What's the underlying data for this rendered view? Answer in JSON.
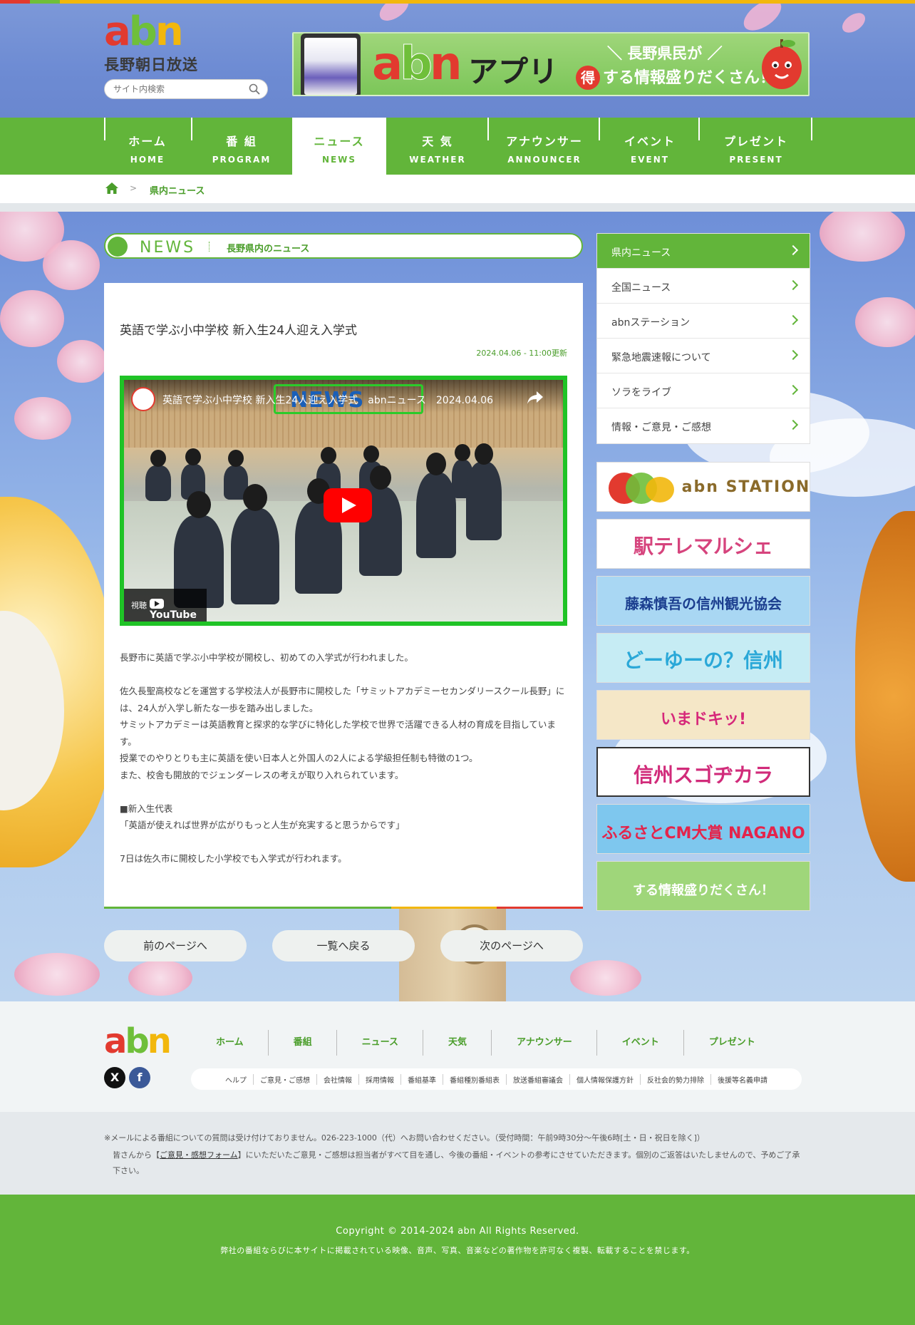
{
  "site": {
    "logo_sub": "長野朝日放送",
    "search_placeholder": "サイト内検索"
  },
  "header_banner": {
    "app_word": "アプリ",
    "tagline_1": "＼ 長野県民が ／",
    "toku": "得",
    "tagline_2": "する情報盛りだくさん！"
  },
  "gnav": [
    {
      "jp": "ホーム",
      "en": "HOME"
    },
    {
      "jp": "番 組",
      "en": "PROGRAM"
    },
    {
      "jp": "ニュース",
      "en": "NEWS"
    },
    {
      "jp": "天 気",
      "en": "WEATHER"
    },
    {
      "jp": "アナウンサー",
      "en": "ANNOUNCER"
    },
    {
      "jp": "イベント",
      "en": "EVENT"
    },
    {
      "jp": "プレゼント",
      "en": "PRESENT"
    }
  ],
  "breadcrumb": {
    "separator": ">",
    "current": "県内ニュース"
  },
  "news_bar": {
    "label": "NEWS",
    "sub": "長野県内のニュース"
  },
  "article": {
    "title": "英語で学ぶ小中学校 新入生24人迎え入学式",
    "date": "2024.04.06 - 11:00更新",
    "video": {
      "title": "英語で学ぶ小中学校 新入生24人迎え入学式　abnニュース　2024.04.06",
      "newsbox": "NEWS",
      "watch_label": "視聴",
      "yt_label": "YouTube"
    },
    "paragraphs": [
      "長野市に英語で学ぶ小中学校が開校し、初めての入学式が行われました。",
      "",
      "佐久長聖高校などを運営する学校法人が長野市に開校した「サミットアカデミーセカンダリースクール長野」には、24人が入学し新たな一歩を踏み出しました。",
      "サミットアカデミーは英語教育と探求的な学びに特化した学校で世界で活躍できる人材の育成を目指しています。",
      "授業でのやりとりも主に英語を使い日本人と外国人の2人による学級担任制も特徴の1つ。",
      "また、校舎も開放的でジェンダーレスの考えが取り入れられています。",
      "",
      "■新入生代表",
      "「英語が使えれば世界が広がりもっと人生が充実すると思うからです」",
      "",
      "7日は佐久市に開校した小学校でも入学式が行われます。"
    ]
  },
  "pager": {
    "prev": "前のページへ",
    "list": "一覧へ戻る",
    "next": "次のページへ"
  },
  "side_menu": [
    "県内ニュース",
    "全国ニュース",
    "abnステーション",
    "緊急地震速報について",
    "ソラをライブ",
    "情報・ご意見・ご感想"
  ],
  "side_banners": [
    {
      "text": "abn STATION",
      "bg": "#ffffff",
      "color": "#8a6a2a"
    },
    {
      "text": "駅テレマルシェ",
      "bg": "#ffffff",
      "color": "#d6447d"
    },
    {
      "text": "藤森慎吾の信州観光協会",
      "bg": "#a9d7f3",
      "color": "#1b3e8f"
    },
    {
      "text": "どーゆーの？信州",
      "bg": "#c6ecf4",
      "color": "#2aa8d8"
    },
    {
      "text": "いまドキッ!",
      "bg": "#f5e7c7",
      "color": "#d6287a"
    },
    {
      "text": "信州スゴヂカラ",
      "bg": "#ffffff",
      "color": "#d12b7a"
    },
    {
      "text": "ふるさとCM大賞 NAGANO",
      "bg": "#7ec7ee",
      "color": "#e4244b"
    },
    {
      "text": "する情報盛りだくさん！",
      "bg": "#9fd67a",
      "color": "#ffffff"
    }
  ],
  "footer": {
    "nav": [
      "ホーム",
      "番組",
      "ニュース",
      "天気",
      "アナウンサー",
      "イベント",
      "プレゼント"
    ],
    "social": [
      "X",
      "f"
    ],
    "sublinks": [
      "ヘルプ",
      "ご意見・ご感想",
      "会社情報",
      "採用情報",
      "番組基準",
      "番組種別番組表",
      "放送番組審議会",
      "個人情報保護方針",
      "反社会的勢力排除",
      "後援等名義申請"
    ],
    "notice_1": "※メールによる番組についての質問は受け付けておりません。026-223-1000（代）へお問い合わせください。（受付時間：午前9時30分〜午後6時[土・日・祝日を除く]）",
    "notice_2a": "皆さんから【",
    "notice_link": "ご意見・感想フォーム",
    "notice_2b": "】にいただいたご意見・ご感想は担当者がすべて目を通し、今後の番組・イベントの参考にさせていただきます。個別のご返答はいたしませんので、予めご了承下さい。",
    "copyright": "Copyright © 2014-2024 abn All Rights Reserved.",
    "copyright_2": "弊社の番組ならびに本サイトに掲載されている映像、音声、写真、音楽などの著作物を許可なく複製、転載することを禁じます。"
  },
  "colors": {
    "brand_green": "#62b53a",
    "red": "#e23a2f",
    "yellow": "#f2b70c"
  }
}
